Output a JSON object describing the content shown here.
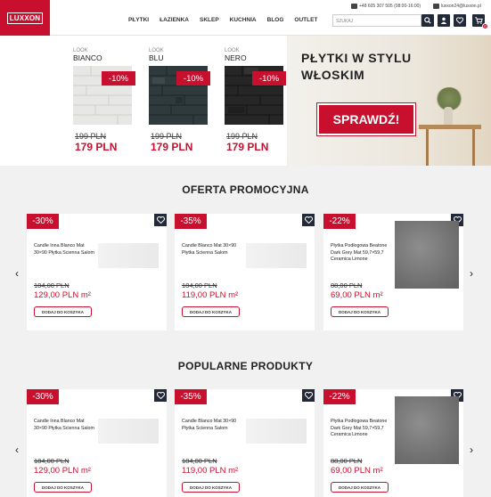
{
  "header": {
    "logo": "LUXXON",
    "nav": [
      "PŁYTKI",
      "ŁAZIENKA",
      "SKLEP",
      "KUCHNIA",
      "BLOG",
      "OUTLET"
    ],
    "phone": "+48 605 307 505 (08:00-16:00)",
    "email": "luxxon24@luxxon.pl",
    "search_placeholder": "SZUKAJ",
    "cart_count": "0"
  },
  "banner": {
    "tiles": [
      {
        "look": "LOOK",
        "name": "BIANCO",
        "discount": "-10%",
        "old_price": "199 PLN",
        "new_price": "179 PLN"
      },
      {
        "look": "LOOK",
        "name": "BLU",
        "discount": "-10%",
        "old_price": "199 PLN",
        "new_price": "179 PLN"
      },
      {
        "look": "LOOK",
        "name": "NERO",
        "discount": "-10%",
        "old_price": "199 PLN",
        "new_price": "179 PLN"
      }
    ],
    "title_line1": "PŁYTKI W STYLU",
    "title_line2": "WŁOSKIM",
    "cta": "SPRAWDŹ!"
  },
  "sections": [
    {
      "title": "OFERTA PROMOCYJNA",
      "products": [
        {
          "discount": "-30%",
          "name": "Candle Inna Blanco Mat 30×90 Płytka Scienna Salom",
          "old_price": "184,00 PLN",
          "new_price": "129,00 PLN m²",
          "button": "DODAJ DO KOSZYKA"
        },
        {
          "discount": "-35%",
          "name": "Candle Blanco Mat 30×90 Płytka Scienna Salom",
          "old_price": "184,00 PLN",
          "new_price": "119,00 PLN m²",
          "button": "DODAJ DO KOSZYKA"
        },
        {
          "discount": "-22%",
          "name": "Płytka Podłogowa Beatone Dark Grey Mat 59,7×59,7 Ceramica Limone",
          "old_price": "88,00 PLN",
          "new_price": "69,00 PLN m²",
          "button": "DODAJ DO KOSZYKA"
        }
      ]
    },
    {
      "title": "POPULARNE PRODUKTY",
      "products": [
        {
          "discount": "-30%",
          "name": "Candle Inna Blanco Mat 30×90 Płytka Scienna Salom",
          "old_price": "184,00 PLN",
          "new_price": "129,00 PLN m²",
          "button": "DODAJ DO KOSZYKA"
        },
        {
          "discount": "-35%",
          "name": "Candle Blanco Mat 30×90 Płytka Scienna Salom",
          "old_price": "184,00 PLN",
          "new_price": "119,00 PLN m²",
          "button": "DODAJ DO KOSZYKA"
        },
        {
          "discount": "-22%",
          "name": "Płytka Podłogowa Beatone Dark Grey Mat 59,7×59,7 Ceramica Limone",
          "old_price": "88,00 PLN",
          "new_price": "69,00 PLN m²",
          "button": "DODAJ DO KOSZYKA"
        }
      ]
    }
  ],
  "icons": {
    "prev": "‹",
    "next": "›",
    "search": "search-icon",
    "user": "user-icon",
    "cart": "cart-icon",
    "heart": "heart-icon"
  },
  "colors": {
    "brand": "#c8102e",
    "dark": "#222a3a"
  }
}
